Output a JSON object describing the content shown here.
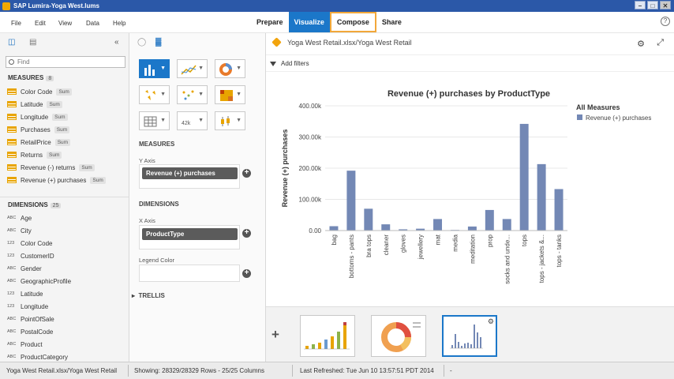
{
  "window": {
    "title": "SAP Lumira-Yoga West.lums"
  },
  "menu": [
    "File",
    "Edit",
    "View",
    "Data",
    "Help"
  ],
  "modes": [
    {
      "label": "Prepare",
      "state": "normal"
    },
    {
      "label": "Visualize",
      "state": "active"
    },
    {
      "label": "Compose",
      "state": "outlined"
    },
    {
      "label": "Share",
      "state": "normal"
    }
  ],
  "left_panel": {
    "search_placeholder": "Find",
    "measures_label": "MEASURES",
    "measures_count": "8",
    "measures": [
      {
        "name": "Color Code",
        "agg": "Sum"
      },
      {
        "name": "Latitude",
        "agg": "Sum"
      },
      {
        "name": "Longitude",
        "agg": "Sum"
      },
      {
        "name": "Purchases",
        "agg": "Sum"
      },
      {
        "name": "RetailPrice",
        "agg": "Sum"
      },
      {
        "name": "Returns",
        "agg": "Sum"
      },
      {
        "name": "Revenue (-) returns",
        "agg": "Sum"
      },
      {
        "name": "Revenue (+) purchases",
        "agg": "Sum"
      }
    ],
    "dimensions_label": "DIMENSIONS",
    "dimensions_count": "25",
    "dimensions": [
      {
        "type": "ABC",
        "name": "Age"
      },
      {
        "type": "ABC",
        "name": "City"
      },
      {
        "type": "123",
        "name": "Color Code"
      },
      {
        "type": "123",
        "name": "CustomerID"
      },
      {
        "type": "ABC",
        "name": "Gender"
      },
      {
        "type": "ABC",
        "name": "GeographicProfile"
      },
      {
        "type": "123",
        "name": "Latitude"
      },
      {
        "type": "123",
        "name": "Longitude"
      },
      {
        "type": "ABC",
        "name": "PointOfSale"
      },
      {
        "type": "ABC",
        "name": "PostalCode"
      },
      {
        "type": "ABC",
        "name": "Product"
      },
      {
        "type": "ABC",
        "name": "ProductCategory"
      }
    ]
  },
  "mid_panel": {
    "measures_label": "MEASURES",
    "y_axis_label": "Y Axis",
    "y_axis_value": "Revenue (+) purchases",
    "dimensions_label": "DIMENSIONS",
    "x_axis_label": "X Axis",
    "x_axis_value": "ProductType",
    "legend_color_label": "Legend Color",
    "trellis_label": "TRELLIS"
  },
  "chart_area": {
    "dataset": "Yoga West Retail.xlsx/Yoga West Retail",
    "add_filters": "Add filters"
  },
  "chart_data": {
    "type": "bar",
    "title": "Revenue (+) purchases by ProductType",
    "ylabel": "Revenue (+) purchases",
    "xlabel": "",
    "categories": [
      "bag",
      "bottoms - pants",
      "bra tops",
      "cleaner",
      "gloves",
      "jewellery",
      "mat",
      "media",
      "meditation",
      "prop",
      "socks and unde...",
      "tops",
      "tops - jackets &...",
      "tops - tanks"
    ],
    "series": [
      {
        "name": "Revenue (+) purchases",
        "values": [
          14000,
          192000,
          70000,
          20000,
          4000,
          6000,
          37000,
          2000,
          13000,
          66000,
          37000,
          342000,
          213000,
          133000
        ]
      }
    ],
    "ylim": [
      0,
      400000
    ],
    "yticks": [
      0,
      100000,
      200000,
      300000,
      400000
    ],
    "ytick_labels": [
      "0.00",
      "100.00k",
      "200.00k",
      "300.00k",
      "400.00k"
    ],
    "legend_title": "All Measures",
    "legend_placement": "top-right",
    "grid": true,
    "bar_color": "#7388b5"
  },
  "status": {
    "source": "Yoga West Retail.xlsx/Yoga West Retail",
    "showing": "Showing: 28329/28329 Rows - 25/25 Columns",
    "refreshed": "Last Refreshed: Tue Jun 10 13:57:51 PDT 2014",
    "extra": "-"
  },
  "colors": {
    "accent": "#1b77c9",
    "compose_outline": "#f2a83a",
    "measure_icon": "#e8a400"
  }
}
